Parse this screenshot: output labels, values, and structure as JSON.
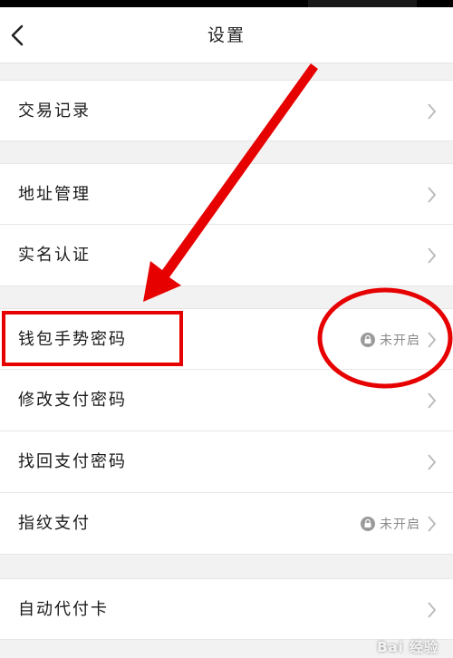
{
  "header": {
    "title": "设置",
    "back_icon": "chevron-left-icon"
  },
  "groups": [
    {
      "items": [
        {
          "label": "交易记录"
        }
      ]
    },
    {
      "items": [
        {
          "label": "地址管理"
        },
        {
          "label": "实名认证"
        }
      ]
    },
    {
      "items": [
        {
          "label": "钱包手势密码",
          "status": "未开启",
          "status_icon": "lock-icon",
          "highlighted": true
        },
        {
          "label": "修改支付密码"
        },
        {
          "label": "找回支付密码"
        },
        {
          "label": "指纹支付",
          "status": "未开启",
          "status_icon": "lock-icon"
        }
      ]
    },
    {
      "items": [
        {
          "label": "自动代付卡"
        }
      ]
    }
  ],
  "annotation": {
    "color": "#e60000",
    "shapes": [
      "arrow",
      "box",
      "circle"
    ]
  },
  "watermark": {
    "text": "Bai 经验"
  },
  "colors": {
    "background": "#f2f2f2",
    "row": "#ffffff",
    "accent": "#e60000",
    "status_text": "#8a8a8a"
  }
}
